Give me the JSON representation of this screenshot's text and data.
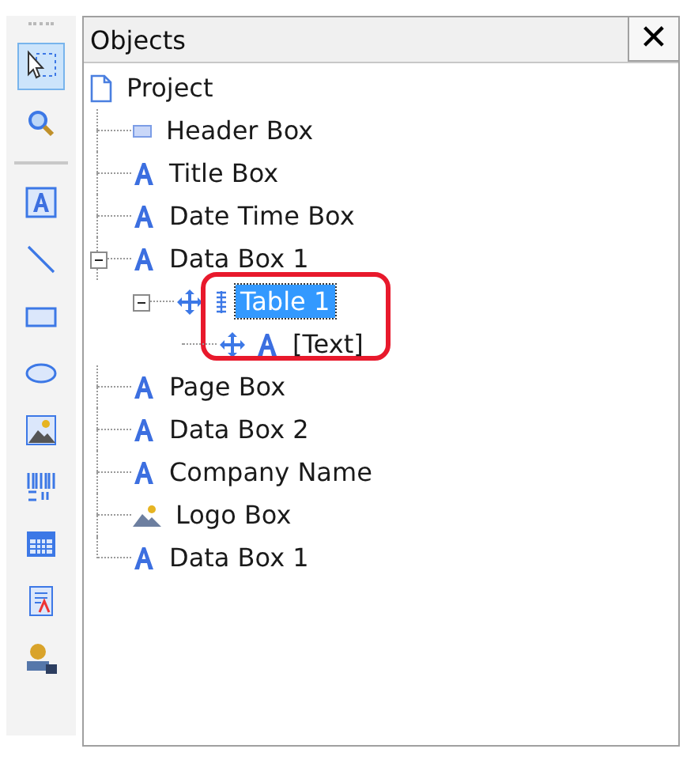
{
  "toolbar": [
    {
      "kind": "select",
      "selected": true
    },
    {
      "kind": "zoom",
      "selected": false
    },
    {
      "kind": "separator"
    },
    {
      "kind": "text",
      "selected": false
    },
    {
      "kind": "line",
      "selected": false
    },
    {
      "kind": "rectangle",
      "selected": false
    },
    {
      "kind": "ellipse",
      "selected": false
    },
    {
      "kind": "image",
      "selected": false
    },
    {
      "kind": "barcode",
      "selected": false
    },
    {
      "kind": "table",
      "selected": false
    },
    {
      "kind": "report",
      "selected": false
    },
    {
      "kind": "user",
      "selected": false
    }
  ],
  "panel": {
    "title": "Objects",
    "close": "✕",
    "tree": [
      {
        "label": "Project",
        "kind": "page",
        "selected": false,
        "children": [
          {
            "label": "Header Box",
            "kind": "header",
            "selected": false
          },
          {
            "label": "Title Box",
            "kind": "text",
            "selected": false
          },
          {
            "label": "Date Time Box",
            "kind": "text",
            "selected": false
          },
          {
            "label": "Data Box 1",
            "kind": "text",
            "selected": false,
            "expanded": true,
            "children": [
              {
                "label": "Table 1",
                "kind": "table",
                "selected": true,
                "circled": true,
                "expanded": true,
                "children": [
                  {
                    "label": "[Text]",
                    "kind": "movetext",
                    "selected": false
                  }
                ]
              }
            ]
          },
          {
            "label": "Page Box",
            "kind": "text",
            "selected": false
          },
          {
            "label": "Data Box 2",
            "kind": "text",
            "selected": false
          },
          {
            "label": "Company Name",
            "kind": "text",
            "selected": false
          },
          {
            "label": "Logo Box",
            "kind": "image",
            "selected": false
          },
          {
            "label": "Data Box 1",
            "kind": "text",
            "selected": false
          }
        ]
      }
    ]
  }
}
